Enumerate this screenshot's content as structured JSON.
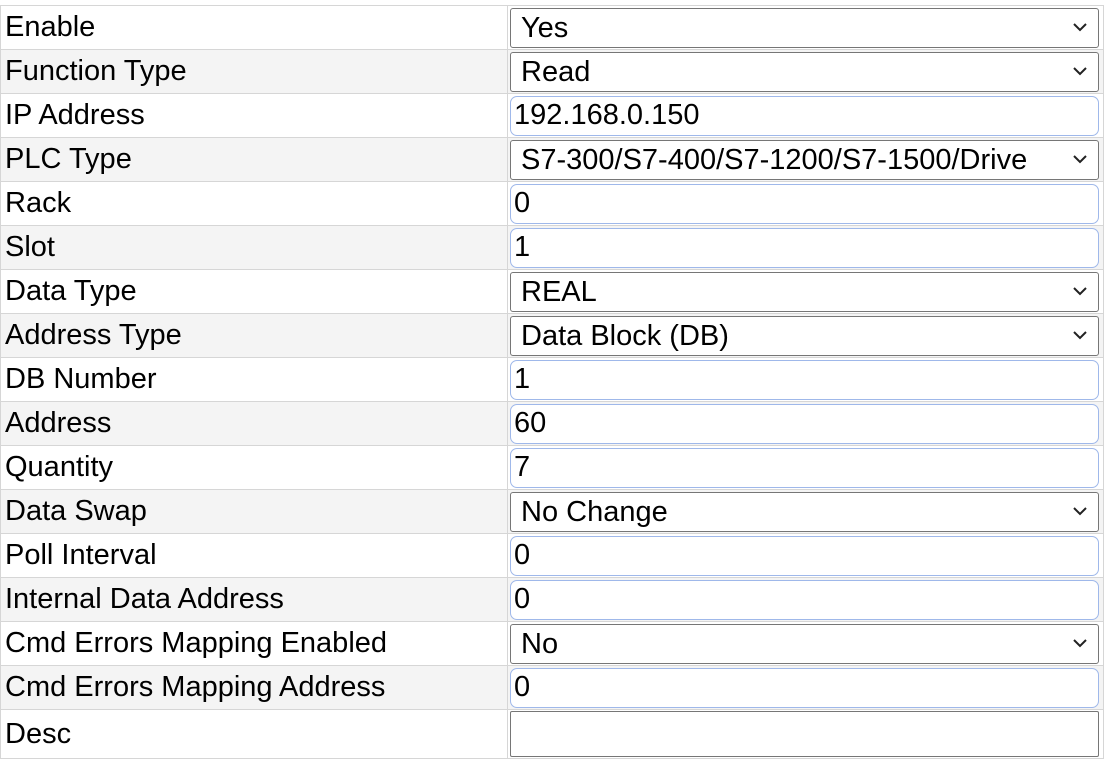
{
  "form": {
    "rows": [
      {
        "label": "Enable",
        "control": "select",
        "value": "Yes"
      },
      {
        "label": "Function Type",
        "control": "select",
        "value": "Read"
      },
      {
        "label": "IP Address",
        "control": "input",
        "value": "192.168.0.150"
      },
      {
        "label": "PLC Type",
        "control": "select",
        "value": "S7-300/S7-400/S7-1200/S7-1500/Drive"
      },
      {
        "label": "Rack",
        "control": "input",
        "value": "0"
      },
      {
        "label": "Slot",
        "control": "input",
        "value": "1"
      },
      {
        "label": "Data Type",
        "control": "select",
        "value": "REAL"
      },
      {
        "label": "Address Type",
        "control": "select",
        "value": "Data Block (DB)"
      },
      {
        "label": "DB Number",
        "control": "input",
        "value": "1"
      },
      {
        "label": "Address",
        "control": "input",
        "value": "60"
      },
      {
        "label": "Quantity",
        "control": "input",
        "value": "7"
      },
      {
        "label": "Data Swap",
        "control": "select",
        "value": "No Change"
      },
      {
        "label": "Poll Interval",
        "control": "input",
        "value": "0"
      },
      {
        "label": "Internal Data Address",
        "control": "input",
        "value": "0"
      },
      {
        "label": "Cmd Errors Mapping Enabled",
        "control": "select",
        "value": "No"
      },
      {
        "label": "Cmd Errors Mapping Address",
        "control": "input",
        "value": "0"
      },
      {
        "label": "Desc",
        "control": "input",
        "value": ""
      }
    ]
  },
  "icons": {
    "dropdown": "chevron-down-icon"
  },
  "colors": {
    "row_alt_background": "#f4f4f4",
    "row_border": "#d6d6d6",
    "select_border": "#767676",
    "input_focus_border": "#9fb8ea"
  }
}
